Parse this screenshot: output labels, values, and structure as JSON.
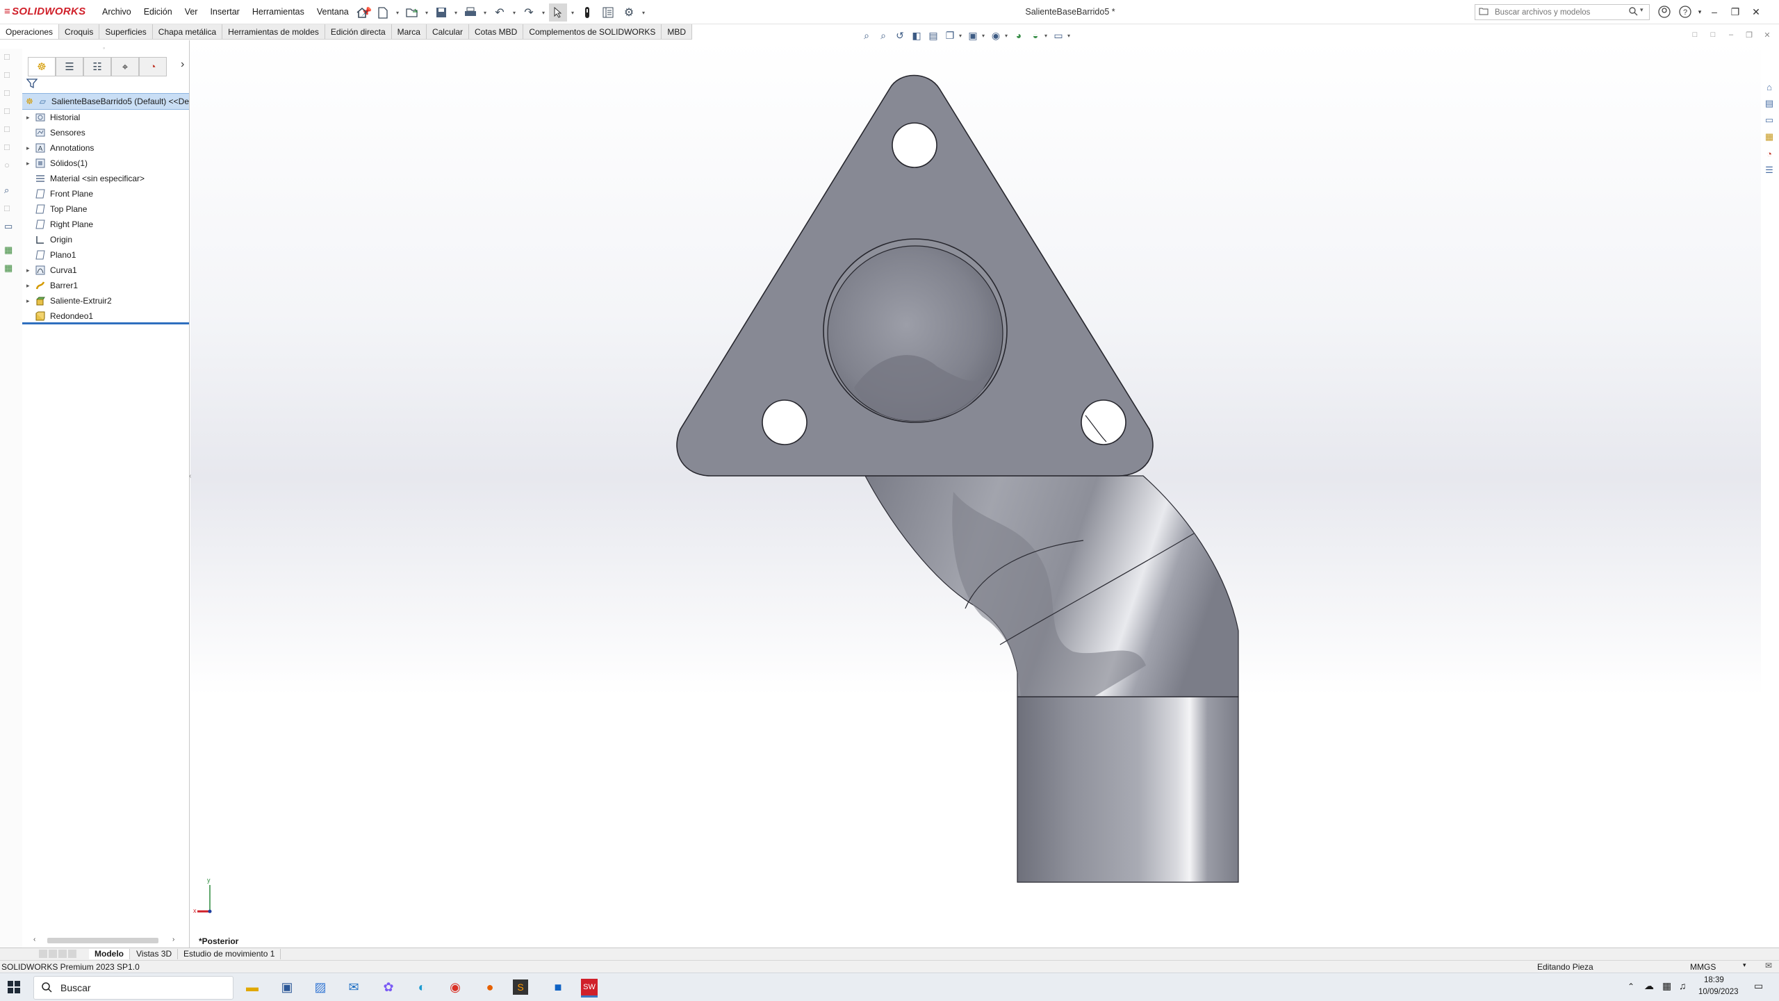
{
  "app": {
    "logo_text": "SOLIDWORKS",
    "document_title": "SalienteBaseBarrido5 *",
    "menu": [
      "Archivo",
      "Edición",
      "Ver",
      "Insertar",
      "Herramientas",
      "Ventana"
    ],
    "search_placeholder": "Buscar archivos y modelos"
  },
  "command_tabs": [
    "Operaciones",
    "Croquis",
    "Superficies",
    "Chapa metálica",
    "Herramientas de moldes",
    "Edición directa",
    "Marca",
    "Calcular",
    "Cotas MBD",
    "Complementos de SOLIDWORKS",
    "MBD"
  ],
  "feature_tree": {
    "root": "SalienteBaseBarrido5 (Default) <<De",
    "items": [
      {
        "label": "Historial",
        "icon": "history-folder-icon",
        "expandable": true
      },
      {
        "label": "Sensores",
        "icon": "sensor-icon",
        "expandable": false
      },
      {
        "label": "Annotations",
        "icon": "annotations-icon",
        "expandable": true
      },
      {
        "label": "Sólidos(1)",
        "icon": "solid-bodies-icon",
        "expandable": true
      },
      {
        "label": "Material <sin especificar>",
        "icon": "material-icon",
        "expandable": false
      },
      {
        "label": "Front Plane",
        "icon": "plane-icon",
        "expandable": false
      },
      {
        "label": "Top Plane",
        "icon": "plane-icon",
        "expandable": false
      },
      {
        "label": "Right Plane",
        "icon": "plane-icon",
        "expandable": false
      },
      {
        "label": "Origin",
        "icon": "origin-icon",
        "expandable": false
      },
      {
        "label": "Plano1",
        "icon": "plane-icon",
        "expandable": false
      },
      {
        "label": "Curva1",
        "icon": "curve-icon",
        "expandable": true
      },
      {
        "label": "Barrer1",
        "icon": "sweep-icon",
        "expandable": true
      },
      {
        "label": "Saliente-Extruir2",
        "icon": "extrude-icon",
        "expandable": true
      },
      {
        "label": "Redondeo1",
        "icon": "fillet-icon",
        "expandable": false
      }
    ]
  },
  "viewport": {
    "view_name": "*Posterior",
    "triad_labels": {
      "x": "x",
      "y": "y"
    }
  },
  "bottom_tabs": [
    "Modelo",
    "Vistas 3D",
    "Estudio de movimiento 1"
  ],
  "status": {
    "version": "SOLIDWORKS Premium 2023 SP1.0",
    "mode": "Editando Pieza",
    "units": "MMGS"
  },
  "taskbar": {
    "search_placeholder": "Buscar",
    "time": "18:39",
    "date": "10/09/2023"
  },
  "colors": {
    "brand_red": "#d0202a",
    "part_gray": "#8a8c96",
    "selection_blue": "#c9def5",
    "rollback_bar": "#2f6fbf"
  }
}
